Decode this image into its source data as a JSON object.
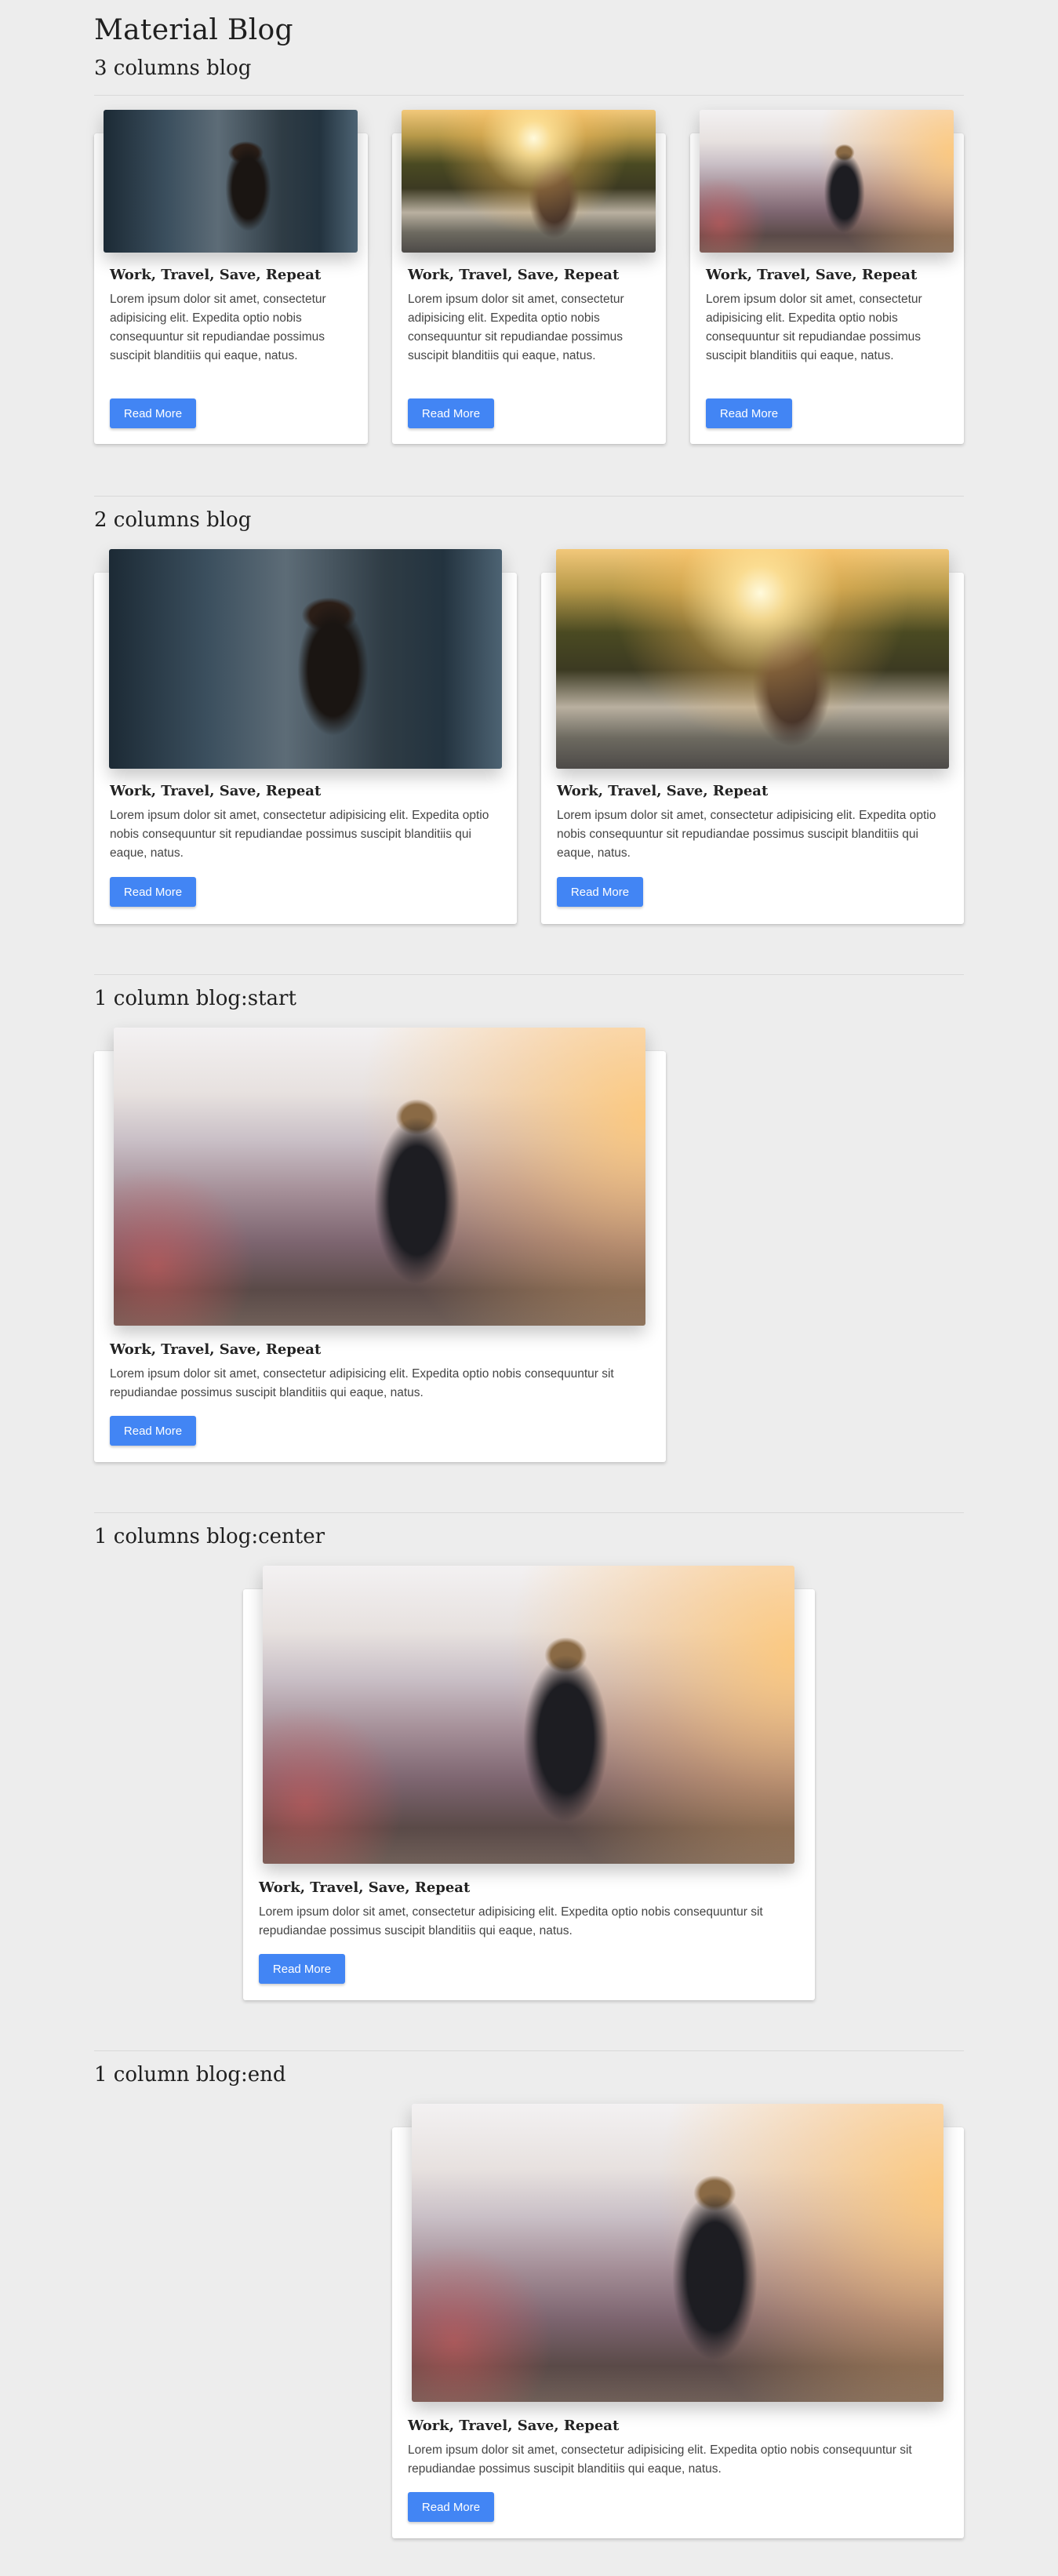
{
  "page": {
    "title": "Material Blog"
  },
  "post": {
    "title": "Work, Travel, Save, Repeat",
    "text": "Lorem ipsum dolor sit amet, consectetur adipisicing elit. Expedita optio nobis consequuntur sit repudiandae possimus suscipit blanditiis qui eaque, natus.",
    "button": "Read More"
  },
  "sections": {
    "three_columns": {
      "title": "3 columns blog"
    },
    "two_columns": {
      "title": "2 columns blog"
    },
    "one_start": {
      "title": "1 column blog:start"
    },
    "one_center": {
      "title": "1 columns blog:center"
    },
    "one_end": {
      "title": "1 column blog:end"
    }
  },
  "images": {
    "woman_back_city": "hair-woman-image",
    "woman_sunset_lake": "sunset-lake-image",
    "woman_mountain": "mountain-view-image"
  },
  "colors": {
    "background": "#ededed",
    "button": "#4285f4"
  }
}
